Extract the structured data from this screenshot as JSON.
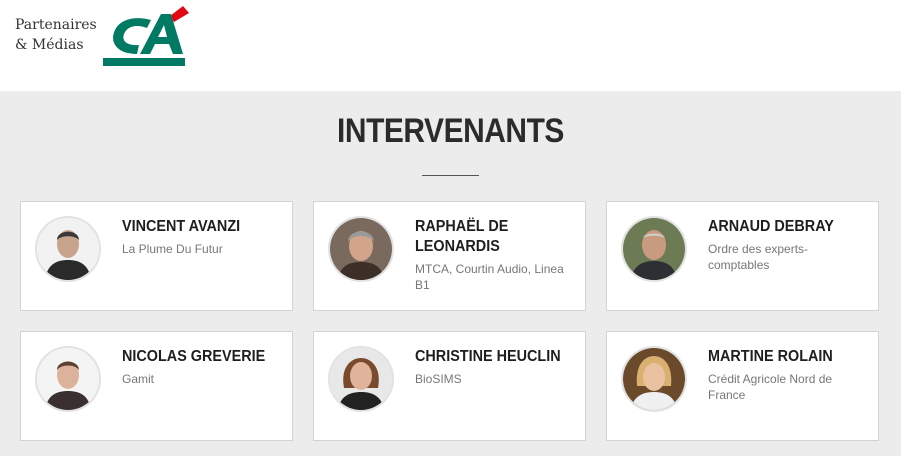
{
  "header": {
    "partners_label_line1": "Partenaires",
    "partners_label_line2": "& Médias",
    "logo_name": "credit-agricole-logo",
    "colors": {
      "logo_green": "#007a62",
      "logo_red": "#e30613",
      "background": "#ececec"
    }
  },
  "section": {
    "title": "INTERVENANTS"
  },
  "speakers": [
    {
      "name": "VINCENT AVANZI",
      "org": "La Plume Du Futur"
    },
    {
      "name": "RAPHAËL DE LEONARDIS",
      "org": "MTCA, Courtin Audio, Linea B1"
    },
    {
      "name": "ARNAUD DEBRAY",
      "org": "Ordre des experts-comptables"
    },
    {
      "name": "NICOLAS GREVERIE",
      "org": "Gamit"
    },
    {
      "name": "CHRISTINE HEUCLIN",
      "org": "BioSIMS"
    },
    {
      "name": "MARTINE ROLAIN",
      "org": "Crédit Agricole Nord de France"
    }
  ]
}
